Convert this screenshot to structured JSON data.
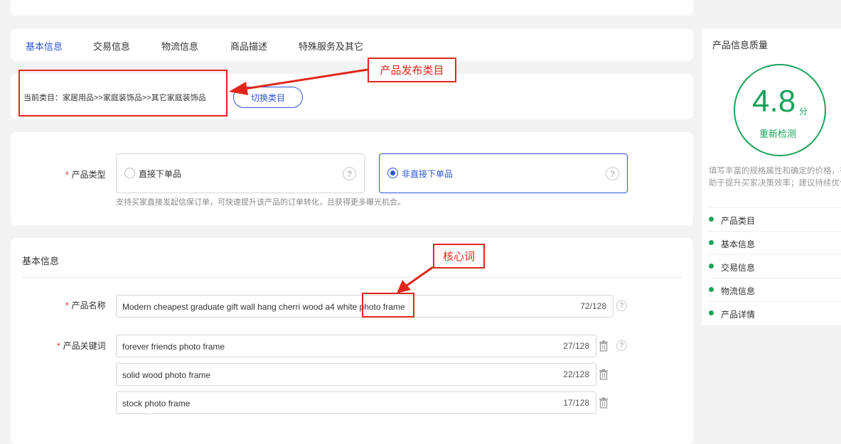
{
  "tabs": [
    "基本信息",
    "交易信息",
    "物流信息",
    "商品描述",
    "特殊服务及其它"
  ],
  "category": {
    "text": "当前类目：家居用品>>家庭装饰品>>其它家庭装饰品",
    "switch_label": "切换类目"
  },
  "product_type": {
    "label": "产品类型",
    "options": [
      "直接下单品",
      "非直接下单品"
    ],
    "selected_index": 1,
    "hint": "支持买家直接发起信保订单，可快速提升该产品的订单转化，且获得更多曝光机会。"
  },
  "basic": {
    "title": "基本信息",
    "name_label": "产品名称",
    "name_value": "Modern cheapest graduate gift wall hang cherri wood a4 white photo frame",
    "name_count": "72/128",
    "keyword_label": "产品关键词",
    "keywords": [
      {
        "value": "forever friends photo frame",
        "count": "27/128"
      },
      {
        "value": "solid wood photo frame",
        "count": "22/128"
      },
      {
        "value": "stock photo frame",
        "count": "17/128"
      }
    ]
  },
  "quality": {
    "title": "产品信息质量",
    "score": "4.8",
    "unit": "分",
    "recheck": "重新检测",
    "desc": "填写丰富的规格属性和确定的价格，有助于提升买家决策效率；建议持续优化!",
    "items": [
      "产品类目",
      "基本信息",
      "交易信息",
      "物流信息",
      "产品详情"
    ]
  },
  "annotations": {
    "category_label": "产品发布类目",
    "keyword_label": "核心词"
  },
  "colors": {
    "accent": "#2f54d6",
    "success": "#19a35b",
    "annotation": "#e1251b"
  },
  "icons": {
    "help": "?",
    "trash": "trash-icon"
  }
}
